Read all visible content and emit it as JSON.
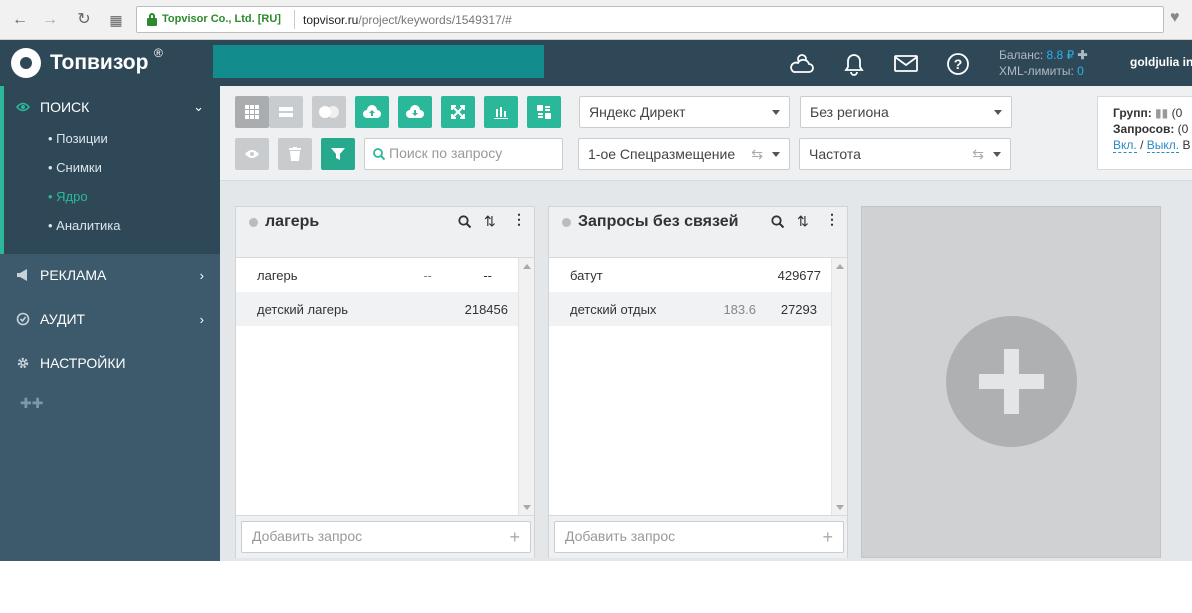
{
  "browser": {
    "cert_label": "Topvisor Co., Ltd. [RU]",
    "url_host": "topvisor.ru",
    "url_path": "/project/keywords/1549317/#"
  },
  "header": {
    "logo": "Топвизор",
    "logo_reg": "®",
    "balance_label": "Баланс:",
    "balance_value": "8.8 ₽",
    "xml_label": "XML-лимиты:",
    "xml_value": "0",
    "username": "goldjulia in"
  },
  "sidebar": {
    "search_label": "ПОИСК",
    "search_items": [
      {
        "label": "• Позиции"
      },
      {
        "label": "• Снимки"
      },
      {
        "label": "• Ядро"
      },
      {
        "label": "• Аналитика"
      }
    ],
    "ads_label": "РЕКЛАМА",
    "audit_label": "АУДИТ",
    "settings_label": "НАСТРОЙКИ"
  },
  "toolbar": {
    "engine_select": "Яндекс Директ",
    "region_select": "Без региона",
    "placement_select": "1-ое Спецразмещение",
    "frequency_select": "Частота",
    "search_placeholder": "Поиск по запросу"
  },
  "info": {
    "groups_label": "Групп:",
    "groups_value": "(0",
    "queries_label": "Запросов:",
    "queries_value": "(0",
    "on_label": "Вкл.",
    "sep": "/",
    "off_label": "Выкл.",
    "tail": "В"
  },
  "panels": [
    {
      "title": "лагерь",
      "rows": [
        {
          "keyword": "лагерь",
          "c1": "--",
          "c2": "--"
        },
        {
          "keyword": "детский лагерь",
          "c1": "",
          "c2": "218456"
        }
      ],
      "add_placeholder": "Добавить запрос"
    },
    {
      "title": "Запросы без связей",
      "rows": [
        {
          "keyword": "батут",
          "c1": "",
          "c2": "429677"
        },
        {
          "keyword": "детский отдых",
          "c1": "183.6",
          "c2": "27293"
        }
      ],
      "add_placeholder": "Добавить запрос"
    }
  ],
  "colors": {
    "brand_dark": "#2f4858",
    "accent_teal": "#2bb89a",
    "sidebar": "#3c5a6c"
  }
}
